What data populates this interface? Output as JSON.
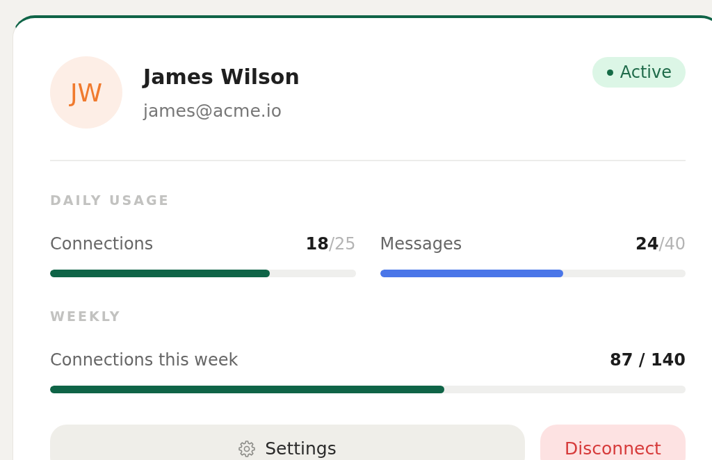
{
  "user": {
    "initials": "JW",
    "name": "James Wilson",
    "email": "james@acme.io"
  },
  "status": {
    "label": "Active"
  },
  "sections": [
    {
      "title": "DAILY USAGE",
      "meters": [
        {
          "kind": "split",
          "label": "Connections",
          "value": "**18**/25",
          "level": 0.72,
          "color": "#0f6447"
        },
        {
          "kind": "split",
          "label": "Messages",
          "value": "**24**/40",
          "level": 0.6,
          "color": "#4a76e8"
        }
      ]
    },
    {
      "title": "WEEKLY",
      "meters": [
        {
          "kind": "total",
          "label": "Connections this week",
          "value": "87 / 140",
          "level": 0.62,
          "color": "#0f6447"
        }
      ]
    }
  ],
  "buttons": [
    {
      "kind": "secondary",
      "label": "Settings"
    },
    {
      "kind": "danger",
      "label": "Disconnect"
    }
  ]
}
